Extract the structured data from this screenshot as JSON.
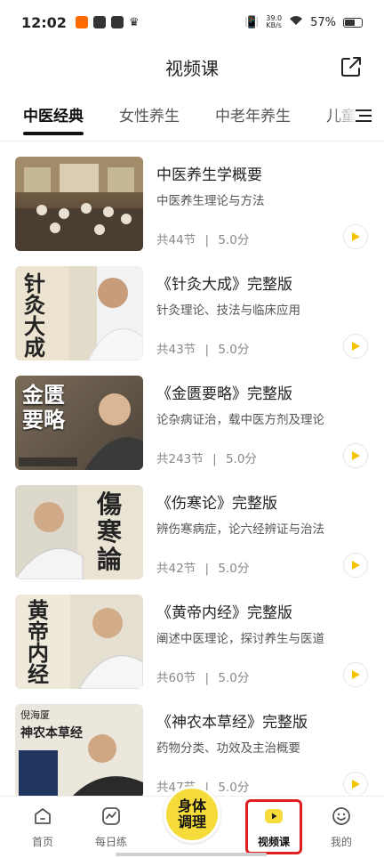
{
  "status_bar": {
    "time": "12:02",
    "net_speed_value": "39.0",
    "net_speed_unit": "KB/s",
    "battery": "57%"
  },
  "header": {
    "title": "视频课"
  },
  "tabs": [
    {
      "label": "中医经典",
      "active": true
    },
    {
      "label": "女性养生",
      "active": false
    },
    {
      "label": "中老年养生",
      "active": false
    },
    {
      "label": "儿童",
      "active": false
    }
  ],
  "courses": [
    {
      "title": "中医养生学概要",
      "desc": "中医养生理论与方法",
      "lessons": "共44节",
      "score": "5.0分",
      "thumb_text": ""
    },
    {
      "title": "《针灸大成》完整版",
      "desc": "针灸理论、技法与临床应用",
      "lessons": "共43节",
      "score": "5.0分",
      "thumb_text": "针灸大成"
    },
    {
      "title": "《金匮要略》完整版",
      "desc": "论杂病证治，载中医方剂及理论",
      "lessons": "共243节",
      "score": "5.0分",
      "thumb_text": "金匮要略"
    },
    {
      "title": "《伤寒论》完整版",
      "desc": "辨伤寒病症，论六经辨证与治法",
      "lessons": "共42节",
      "score": "5.0分",
      "thumb_text": "傷寒論"
    },
    {
      "title": "《黄帝内经》完整版",
      "desc": "阐述中医理论，探讨养生与医道",
      "lessons": "共60节",
      "score": "5.0分",
      "thumb_text": "黄帝内经"
    },
    {
      "title": "《神农本草经》完整版",
      "desc": "药物分类、功效及主治概要",
      "lessons": "共47节",
      "score": "5.0分",
      "thumb_text": "神农本草经",
      "thumb_author": "倪海厦"
    }
  ],
  "meta_separator": "|",
  "bottom_nav": {
    "home": "首页",
    "daily": "每日练",
    "center_line1": "身体",
    "center_line2": "调理",
    "video": "视频课",
    "mine": "我的"
  },
  "colors": {
    "accent_yellow": "#f5dc3a",
    "play_yellow": "#f5c400",
    "highlight_red": "#e02020"
  }
}
